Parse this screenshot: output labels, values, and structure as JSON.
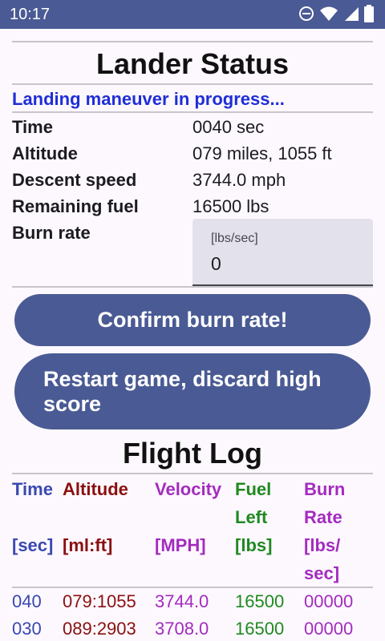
{
  "statusbar": {
    "time": "10:17"
  },
  "header": {
    "title": "Lander Status"
  },
  "status": {
    "message": "Landing maneuver in progress..."
  },
  "stats": [
    {
      "label": "Time",
      "value": "0040 sec"
    },
    {
      "label": "Altitude",
      "value": "079 miles, 1055 ft"
    },
    {
      "label": "Descent speed",
      "value": "3744.0 mph"
    },
    {
      "label": "Remaining fuel",
      "value": "16500 lbs"
    }
  ],
  "burn": {
    "label": "Burn rate",
    "placeholder": "[lbs/sec]",
    "value": "0"
  },
  "buttons": {
    "confirm": "Confirm burn rate!",
    "restart": "Restart game, discard high score"
  },
  "log": {
    "title": "Flight Log",
    "columns": [
      {
        "key": "time",
        "line1": "Time",
        "line2": "",
        "line3": "[sec]",
        "line4": "",
        "color": "#3a48b0"
      },
      {
        "key": "alt",
        "line1": "Altitude",
        "line2": "",
        "line3": "[ml:ft]",
        "line4": "",
        "color": "#8a1010"
      },
      {
        "key": "vel",
        "line1": "Velocity",
        "line2": "",
        "line3": "[MPH]",
        "line4": "",
        "color": "#a42bbf"
      },
      {
        "key": "fuel",
        "line1": "Fuel",
        "line2": "Left",
        "line3": "[lbs]",
        "line4": "",
        "color": "#1f8a1f"
      },
      {
        "key": "burn",
        "line1": "Burn",
        "line2": "Rate",
        "line3": "[lbs/",
        "line4": "sec]",
        "color": "#a42bbf"
      }
    ],
    "rows": [
      {
        "time": "040",
        "alt": "079:1055",
        "vel": "3744.0",
        "fuel": "16500",
        "burn": "00000"
      },
      {
        "time": "030",
        "alt": "089:2903",
        "vel": "3708.0",
        "fuel": "16500",
        "burn": "00000"
      }
    ]
  },
  "colors": {
    "accent": "#4a5a94",
    "status_blue": "#1f2ed6"
  },
  "icons": [
    "do-not-disturb-icon",
    "wifi-icon",
    "cell-signal-icon",
    "battery-icon"
  ]
}
